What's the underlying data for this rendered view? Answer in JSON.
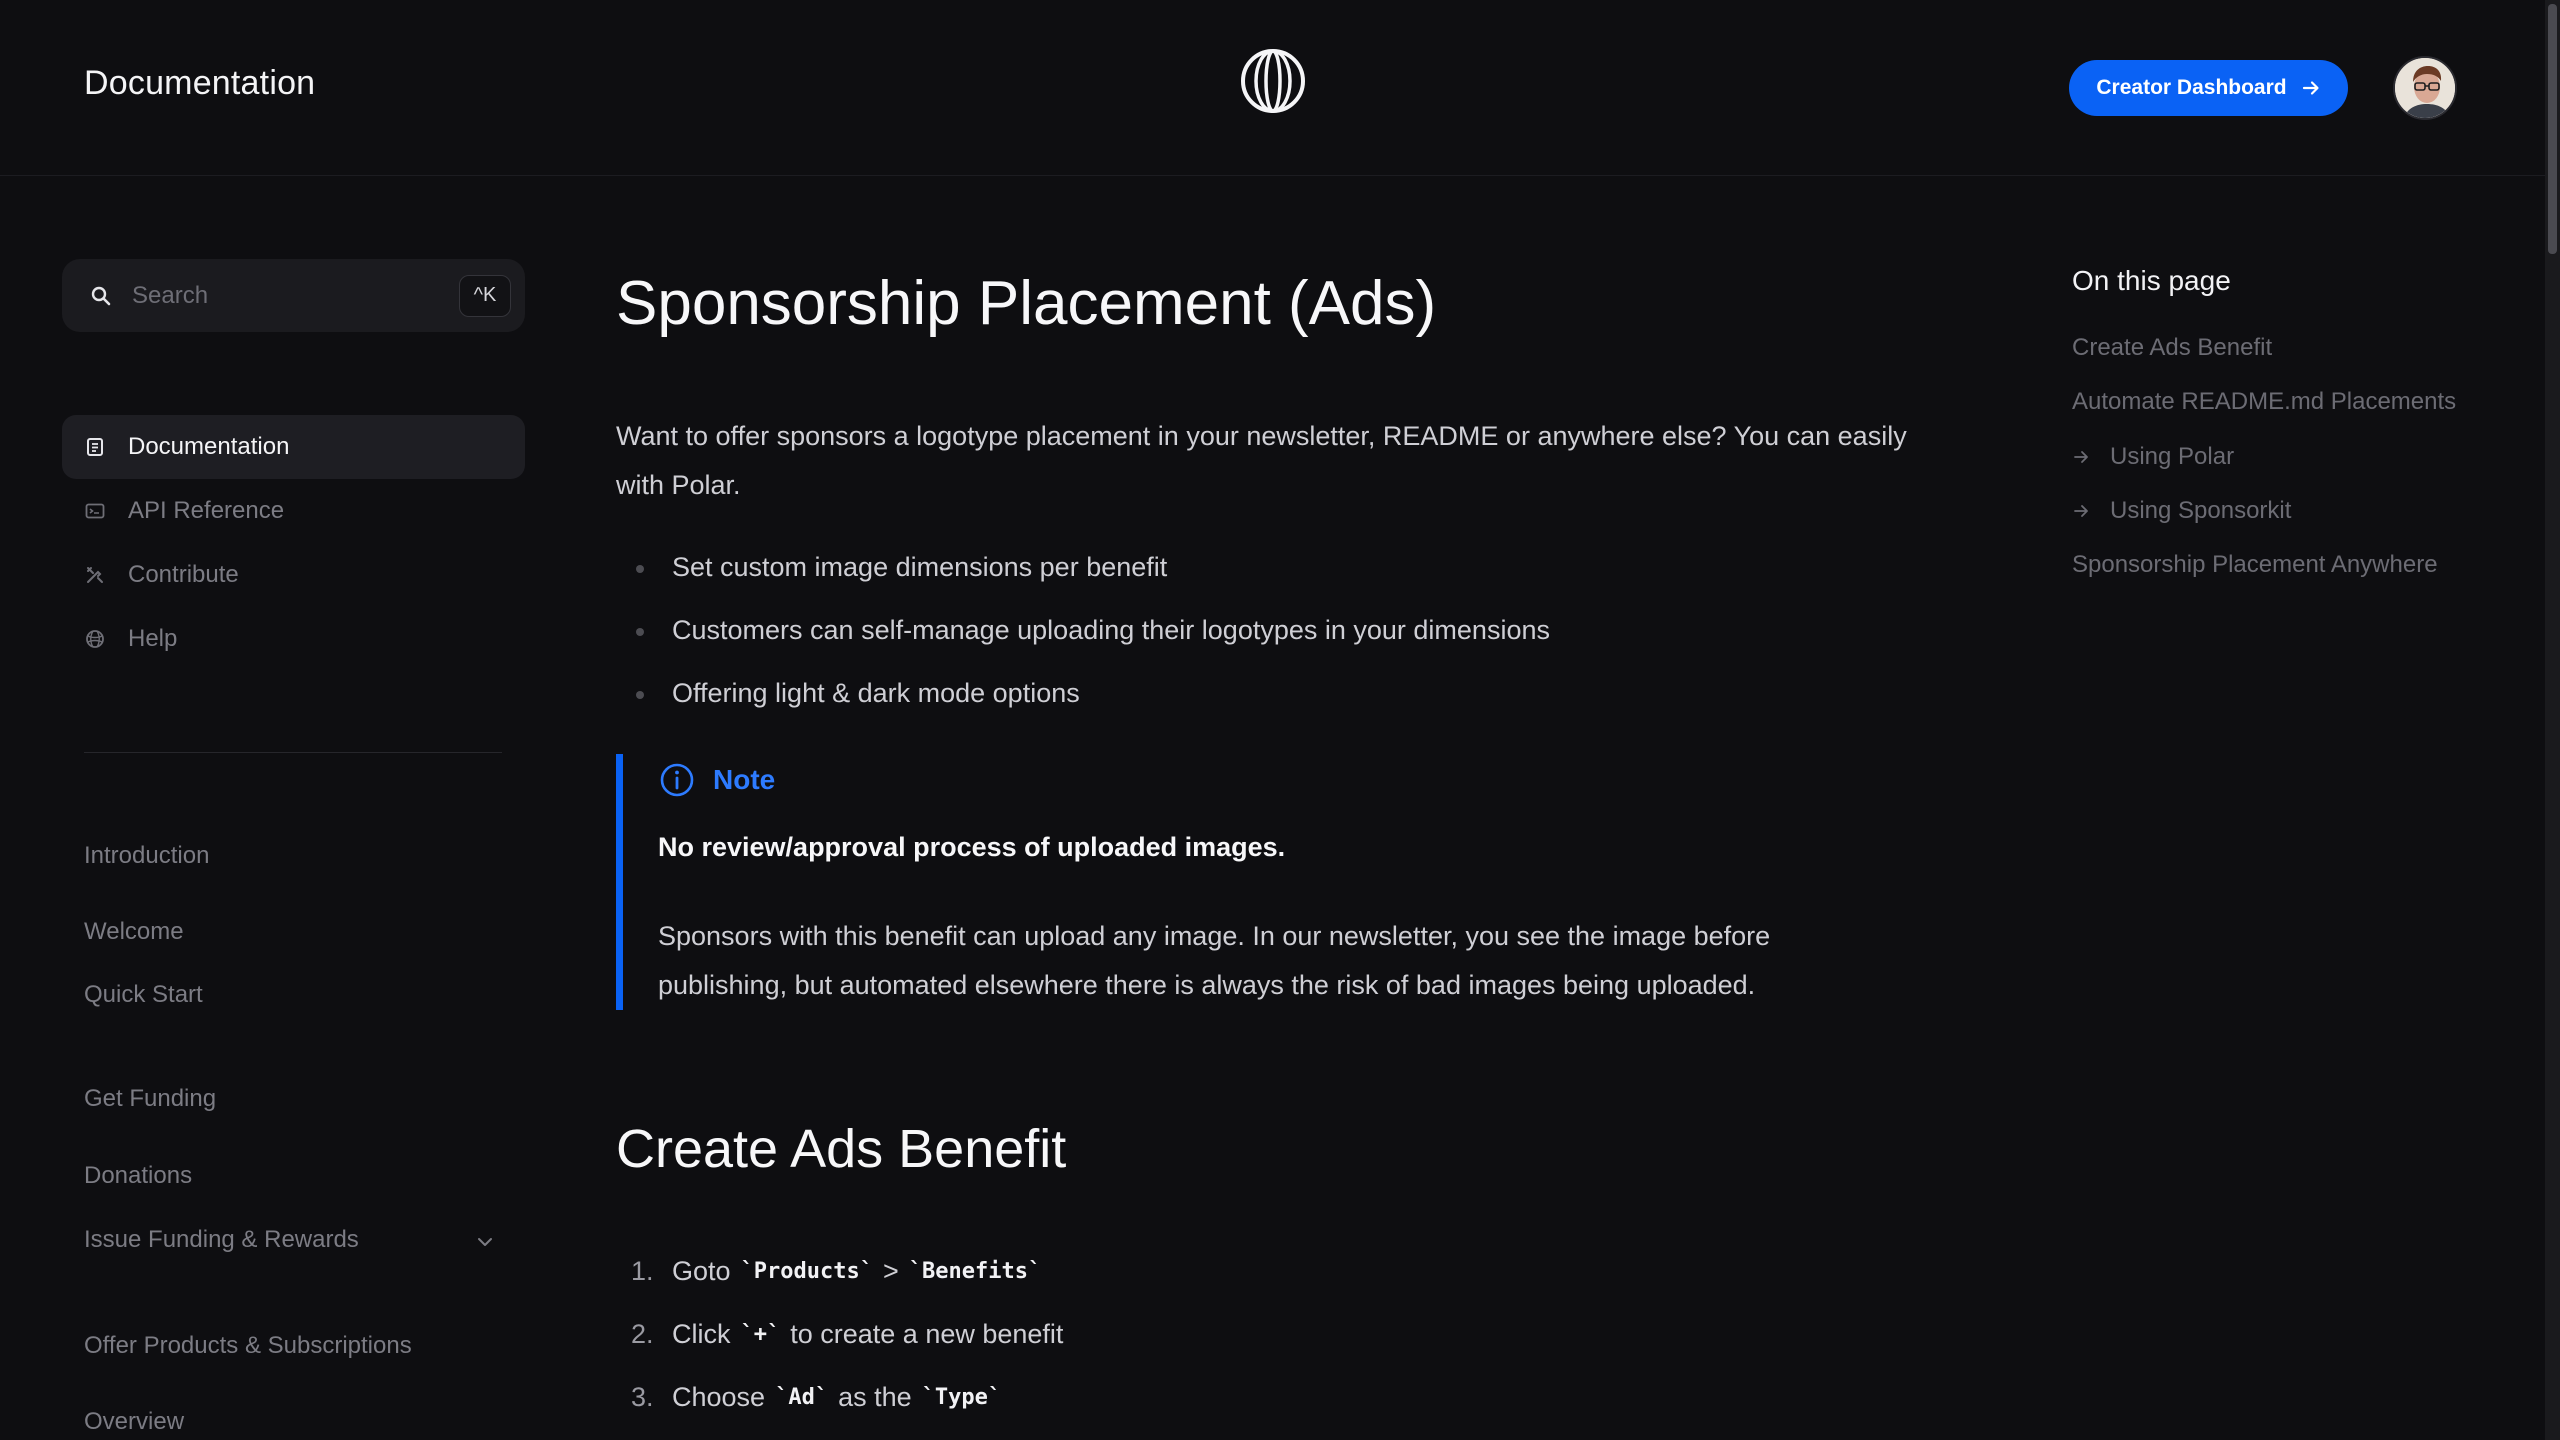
{
  "header": {
    "title": "Documentation",
    "logo_icon": "polar-logo-icon",
    "cta_label": "Creator Dashboard",
    "accent_color": "#0a62f5"
  },
  "sidebar": {
    "search": {
      "placeholder": "Search",
      "shortcut": "^K"
    },
    "primary": [
      {
        "label": "Documentation",
        "icon": "document-icon",
        "active": true
      },
      {
        "label": "API Reference",
        "icon": "terminal-icon",
        "active": false
      },
      {
        "label": "Contribute",
        "icon": "tools-icon",
        "active": false
      },
      {
        "label": "Help",
        "icon": "globe-icon",
        "active": false
      }
    ],
    "sections": [
      {
        "label": "Introduction"
      },
      {
        "label": "Welcome"
      },
      {
        "label": "Quick Start"
      },
      {
        "label": "Get Funding"
      },
      {
        "label": "Donations"
      },
      {
        "label": "Issue Funding & Rewards"
      },
      {
        "label": "Offer Products & Subscriptions"
      },
      {
        "label": "Overview"
      }
    ]
  },
  "main": {
    "title": "Sponsorship Placement (Ads)",
    "intro": "Want to offer sponsors a logotype placement in your newsletter, README or anywhere else? You can easily with Polar.",
    "bullets": [
      "Set custom image dimensions per benefit",
      "Customers can self-manage uploading their logotypes in your dimensions",
      "Offering light & dark mode options"
    ],
    "note": {
      "title": "Note",
      "strong": "No review/approval process of uploaded images.",
      "body": "Sponsors with this benefit can upload any image. In our newsletter, you see the image before publishing, but automated elsewhere there is always the risk of bad images being uploaded."
    },
    "section_title": "Create Ads Benefit",
    "steps": [
      {
        "num": "1.",
        "a": "Goto",
        "code1": "`Products`",
        "b": ">",
        "code2": "`Benefits`",
        "c": ""
      },
      {
        "num": "2.",
        "a": "Click",
        "code1": "`+`",
        "b": "to create a new benefit",
        "code2": "",
        "c": ""
      },
      {
        "num": "3.",
        "a": "Choose",
        "code1": "`Ad`",
        "b": "as the",
        "code2": "`Type`",
        "c": ""
      }
    ]
  },
  "toc": {
    "title": "On this page",
    "items": [
      {
        "label": "Create Ads Benefit"
      },
      {
        "label": "Automate README.md Placements"
      },
      {
        "label": "Using Polar"
      },
      {
        "label": "Using Sponsorkit"
      },
      {
        "label": "Sponsorship Placement Anywhere"
      }
    ]
  }
}
